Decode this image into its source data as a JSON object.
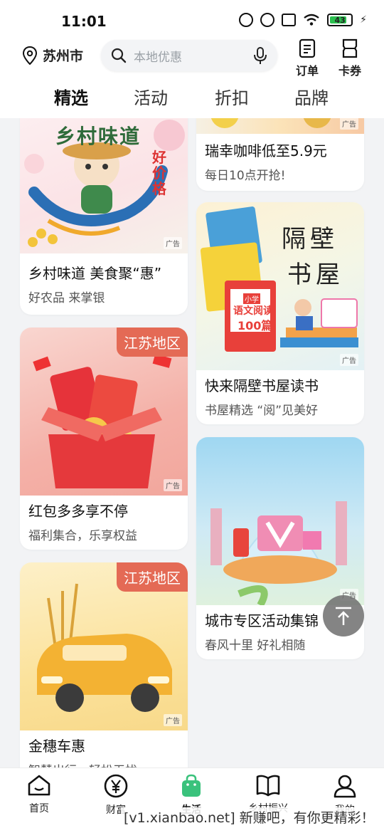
{
  "status": {
    "time": "11:01",
    "battery": "43"
  },
  "header": {
    "city": "苏州市",
    "search_placeholder": "本地优惠",
    "orders_label": "订单",
    "coupons_label": "卡券"
  },
  "tabs": [
    {
      "label": "精选",
      "active": true
    },
    {
      "label": "活动",
      "active": false
    },
    {
      "label": "折扣",
      "active": false
    },
    {
      "label": "品牌",
      "active": false
    }
  ],
  "cards": {
    "village": {
      "banner": "乡村味道",
      "stamp": "好价格",
      "title": "乡村味道 美食聚“惠”",
      "sub": "好农品 来掌银",
      "ad": "广告"
    },
    "coffee": {
      "title": "瑞幸咖啡低至5.9元",
      "sub": "每日10点开抢!",
      "ad": "广告"
    },
    "books": {
      "banner_line1": "隔壁",
      "banner_line2": "书屋",
      "book_text_1": "小学",
      "book_text_2": "语文阅读",
      "book_text_3": "100篇",
      "title": "快来隔壁书屋读书",
      "sub": "书屋精选 “阅”见美好",
      "ad": "广告"
    },
    "redpacket": {
      "region": "江苏地区",
      "title": "红包多多享不停",
      "sub": "福利集合，乐享权益",
      "ad": "广告"
    },
    "city": {
      "title": "城市专区活动集锦",
      "sub": "春风十里 好礼相随",
      "ad": "广告"
    },
    "car": {
      "region": "江苏地区",
      "title": "金穗车惠",
      "sub": "智慧出行，轻松无忧",
      "ad": "广告"
    }
  },
  "bottom_nav": [
    {
      "label": "首页",
      "icon": "home-icon"
    },
    {
      "label": "财富",
      "icon": "yen-icon"
    },
    {
      "label": "生活",
      "icon": "shopping-bag-icon",
      "active": true
    },
    {
      "label": "乡村振兴",
      "icon": "book-icon"
    },
    {
      "label": "我的",
      "icon": "person-icon"
    }
  ],
  "watermark": "[v1.xianbao.net] 新赚吧，有你更精彩！",
  "colors": {
    "accent": "#3ac27c",
    "region_tag": "#e46a55"
  }
}
